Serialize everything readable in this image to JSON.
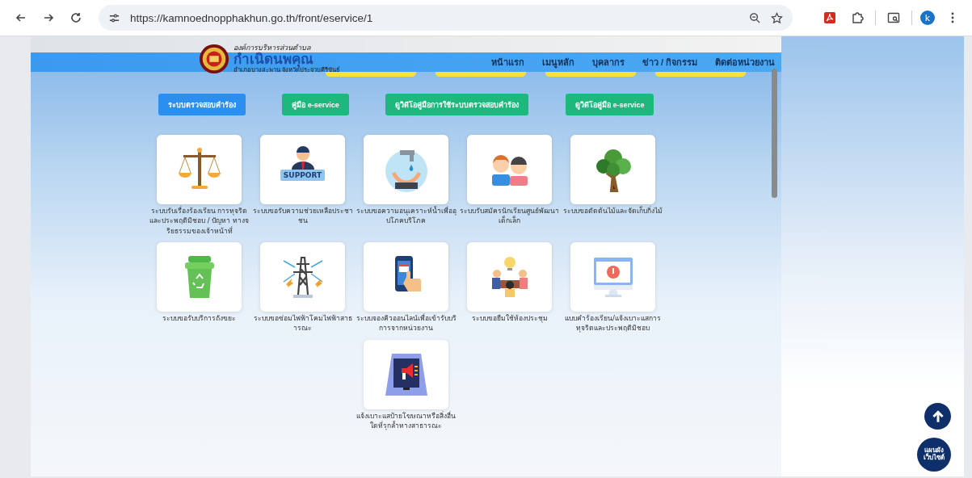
{
  "browser": {
    "url": "https://kamnoednopphakhun.go.th/front/eservice/1",
    "profile": "k"
  },
  "header": {
    "org_line": "องค์การบริหารส่วนตำบล",
    "org_name": "กำเนิดนพคุณ",
    "org_location": "อำเภอบางสะพาน จังหวัดประจวบคีรีขันธ์"
  },
  "nav": [
    "หน้าแรก",
    "เมนูหลัก",
    "บุคลากร",
    "ข่าว / กิจกรรม",
    "ติดต่อหน่วยงาน"
  ],
  "buttons": [
    {
      "label": "ระบบตรวจสอบคำร้อง",
      "color": "#2b8ff0"
    },
    {
      "label": "คู่มือ e-service",
      "color": "#1cb87c"
    },
    {
      "label": "ดูวิดีโอคู่มือการใช้ระบบตรวจสอบคำร้อง",
      "color": "#1cb87c"
    },
    {
      "label": "ดูวิดีโอคู่มือ e-service",
      "color": "#1cb87c"
    }
  ],
  "services": [
    {
      "kind": "scales",
      "label": "ระบบรับเรื่องร้องเรียน การทุจริตและประพฤติมิชอบ / ปัญหา ทางจริยธรรมของเจ้าหน้าที่"
    },
    {
      "kind": "support",
      "label": "ระบบขอรับความช่วยเหลือประชาชน",
      "badge": "SUPPORT"
    },
    {
      "kind": "water",
      "label": "ระบบขอความอนุเคราะห์น้ำเพื่ออุปโภคบริโภค"
    },
    {
      "kind": "kids",
      "label": "ระบบรับสมัครนักเรียนศูนย์พัฒนาเด็กเล็ก"
    },
    {
      "kind": "tree",
      "label": "ระบบขอตัดต้นไม้และจัดเก็บกิ่งไม้"
    },
    {
      "kind": "bin",
      "label": "ระบบขอรับบริการถังขยะ"
    },
    {
      "kind": "tower",
      "label": "ระบบขอซ่อมไฟฟ้าโคมไฟฟ้าสาธารณะ"
    },
    {
      "kind": "phone",
      "label": "ระบบจองคิวออนไลน์เพื่อเข้ารับบริการจากหน่วยงาน"
    },
    {
      "kind": "meeting",
      "label": "ระบบขอยืมใช้ห้องประชุม"
    },
    {
      "kind": "monitor",
      "label": "แบบคำร้องเรียน/แจ้งเบาะแสการทุจริตและประพฤติมิชอบ"
    },
    {
      "kind": "sign",
      "label": "แจ้งเบาะแสป้ายโฆษณาหรือสิ่งอื่นใดที่รุกล้ำทางสาธารณะ"
    }
  ],
  "sitemap_button": "แผนผัง เว็บไซต์"
}
